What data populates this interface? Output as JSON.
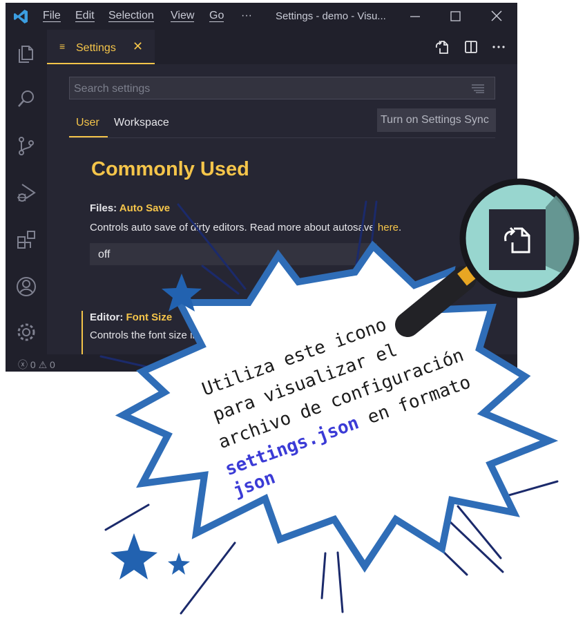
{
  "titlebar": {
    "menu": [
      "File",
      "Edit",
      "Selection",
      "View",
      "Go",
      "···"
    ],
    "title": "Settings - demo - Visu..."
  },
  "activity_icons": [
    "files-icon",
    "search-icon",
    "source-control-icon",
    "run-debug-icon",
    "extensions-icon",
    "account-icon",
    "gear-icon"
  ],
  "tab": {
    "icon": "≡",
    "label": "Settings",
    "close": "✕"
  },
  "editor": {
    "search_placeholder": "Search settings",
    "scopes": {
      "user": "User",
      "workspace": "Workspace"
    },
    "sync_button": "Turn on Settings Sync",
    "section_title": "Commonly Used",
    "auto_save": {
      "category": "Files: ",
      "name": "Auto Save",
      "desc_prefix": "Controls auto save of dirty editors. Read more about autosave ",
      "desc_link": "here",
      "desc_suffix": ".",
      "value": "off"
    },
    "font_size": {
      "category": "Editor: ",
      "name": "Font Size",
      "desc": "Controls the font size in pixels"
    }
  },
  "statusbar": {
    "problems": "ⓧ 0 ⚠ 0"
  },
  "callout": {
    "line1": "Utiliza este icono",
    "line2": "para visualizar el",
    "line3": "archivo de configuración",
    "line4_code": "settings.json",
    "line4_text": " en formato",
    "line5_code": "json"
  },
  "colors": {
    "accent": "#f5c54a",
    "editor_bg": "#262633",
    "chrome_bg": "#20202b",
    "burst_border": "#2f6db7",
    "code_text": "#3b3bd6",
    "lens": "#98d6cf"
  }
}
